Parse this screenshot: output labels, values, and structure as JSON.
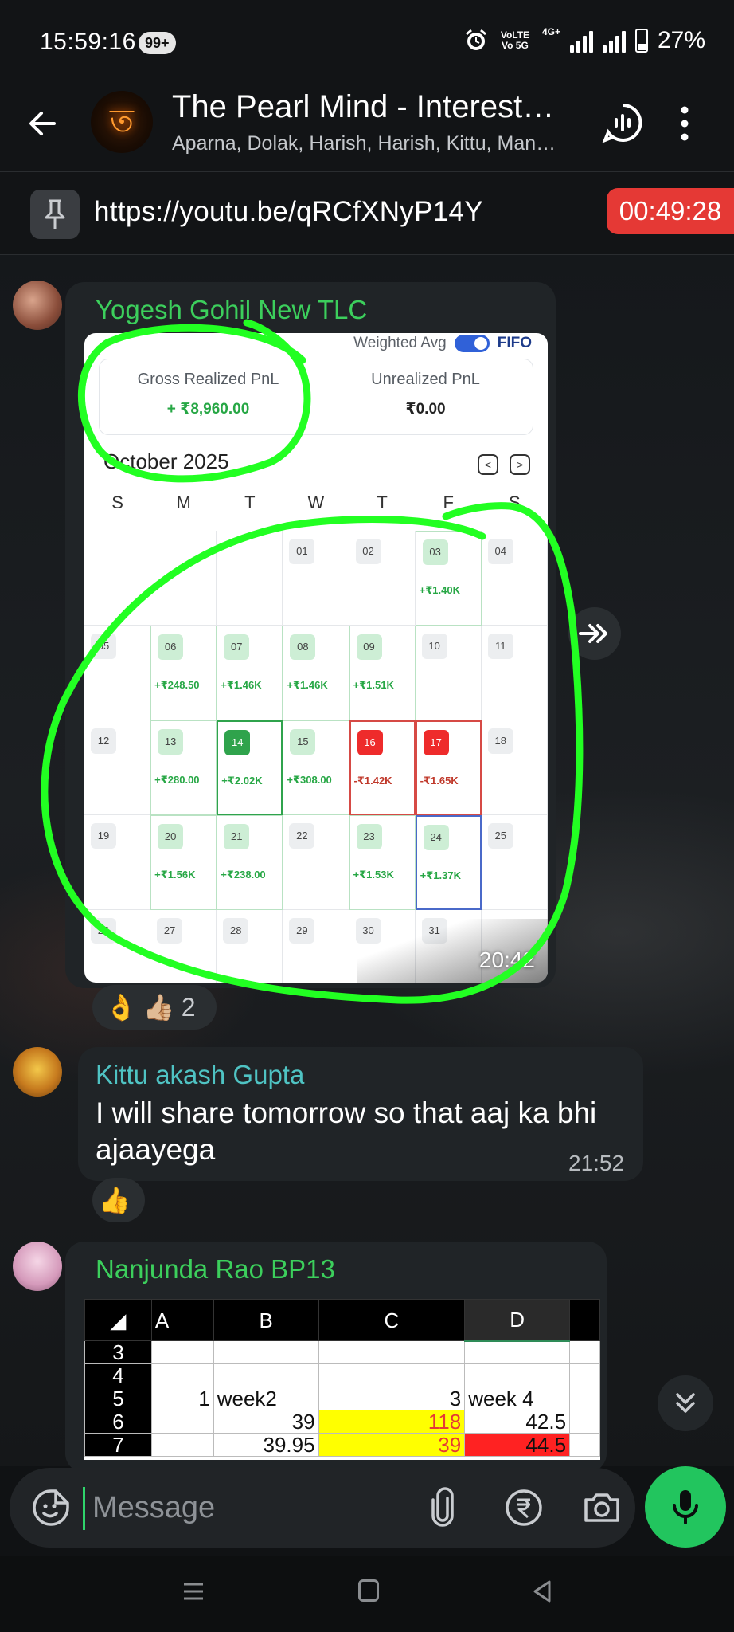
{
  "status_bar": {
    "time": "15:59:16",
    "notif_count": "99+",
    "network": "VoLTE Vo 5G",
    "net_type": "4G+",
    "battery": "27%"
  },
  "header": {
    "title": "The Pearl Mind - Intereste…",
    "subtitle": "Aparna, Dolak, Harish, Harish, Kittu, Man…",
    "avatar_glyph": "ত"
  },
  "pinned": {
    "link": "https://youtu.be/qRCfXNyP14Y",
    "timer": "00:49:28"
  },
  "messages": [
    {
      "sender": "Yogesh Gohil New TLC",
      "sender_color": "#3ccf5c",
      "time": "20:42",
      "reactions": {
        "emoji1": "👌",
        "emoji2": "👍🏼",
        "count": "2"
      },
      "screenshot": {
        "toggle_label": "Weighted Avg",
        "toggle_right": "FIFO",
        "gross_label": "Gross Realized PnL",
        "gross_value": "+ ₹8,960.00",
        "unrealized_label": "Unrealized PnL",
        "unrealized_value": "₹0.00",
        "month": "October 2025",
        "weekdays": [
          "S",
          "M",
          "T",
          "W",
          "T",
          "F",
          "S"
        ],
        "days": [
          {
            "d": "",
            "pnl": "",
            "state": "empty"
          },
          {
            "d": "",
            "pnl": "",
            "state": "empty"
          },
          {
            "d": "",
            "pnl": "",
            "state": "empty"
          },
          {
            "d": "01",
            "pnl": "",
            "state": "none"
          },
          {
            "d": "02",
            "pnl": "",
            "state": "none"
          },
          {
            "d": "03",
            "pnl": "+₹1.40K",
            "state": "gain"
          },
          {
            "d": "04",
            "pnl": "",
            "state": "none"
          },
          {
            "d": "05",
            "pnl": "",
            "state": "none"
          },
          {
            "d": "06",
            "pnl": "+₹248.50",
            "state": "gain"
          },
          {
            "d": "07",
            "pnl": "+₹1.46K",
            "state": "gain"
          },
          {
            "d": "08",
            "pnl": "+₹1.46K",
            "state": "gain"
          },
          {
            "d": "09",
            "pnl": "+₹1.51K",
            "state": "gain"
          },
          {
            "d": "10",
            "pnl": "",
            "state": "none"
          },
          {
            "d": "11",
            "pnl": "",
            "state": "none"
          },
          {
            "d": "12",
            "pnl": "",
            "state": "none"
          },
          {
            "d": "13",
            "pnl": "+₹280.00",
            "state": "gain"
          },
          {
            "d": "14",
            "pnl": "+₹2.02K",
            "state": "today"
          },
          {
            "d": "15",
            "pnl": "+₹308.00",
            "state": "gain"
          },
          {
            "d": "16",
            "pnl": "-₹1.42K",
            "state": "loss"
          },
          {
            "d": "17",
            "pnl": "-₹1.65K",
            "state": "loss"
          },
          {
            "d": "18",
            "pnl": "",
            "state": "none"
          },
          {
            "d": "19",
            "pnl": "",
            "state": "none"
          },
          {
            "d": "20",
            "pnl": "+₹1.56K",
            "state": "gain"
          },
          {
            "d": "21",
            "pnl": "+₹238.00",
            "state": "gain"
          },
          {
            "d": "22",
            "pnl": "",
            "state": "none"
          },
          {
            "d": "23",
            "pnl": "+₹1.53K",
            "state": "gain"
          },
          {
            "d": "24",
            "pnl": "+₹1.37K",
            "state": "sel"
          },
          {
            "d": "25",
            "pnl": "",
            "state": "none"
          },
          {
            "d": "26",
            "pnl": "",
            "state": "none"
          },
          {
            "d": "27",
            "pnl": "",
            "state": "none"
          },
          {
            "d": "28",
            "pnl": "",
            "state": "none"
          },
          {
            "d": "29",
            "pnl": "",
            "state": "none"
          },
          {
            "d": "30",
            "pnl": "",
            "state": "none"
          },
          {
            "d": "31",
            "pnl": "",
            "state": "none"
          },
          {
            "d": "",
            "pnl": "",
            "state": "none"
          }
        ]
      }
    },
    {
      "sender": "Kittu akash Gupta",
      "sender_color": "#4fc3c3",
      "line1": "I will share tomorrow so that aaj ka bhi",
      "line2": "ajaayega",
      "time": "21:52",
      "reaction": "👍"
    },
    {
      "sender": "Nanjunda Rao BP13",
      "sender_color": "#3ccf5c",
      "sheet": {
        "columns": [
          "A",
          "B",
          "C",
          "D"
        ],
        "rows": [
          {
            "n": "3",
            "a": "",
            "b": "",
            "c": "",
            "d": ""
          },
          {
            "n": "4",
            "a": "",
            "b": "",
            "c": "",
            "d": ""
          },
          {
            "n": "5",
            "a": "1",
            "b": "week2",
            "c": "3",
            "d": "week 4"
          },
          {
            "n": "6",
            "a": "",
            "b": "39",
            "c": "118",
            "d": "42.5"
          },
          {
            "n": "7",
            "a": "",
            "b": "39.95",
            "c": "39",
            "d": "44.5"
          }
        ]
      }
    }
  ],
  "composer": {
    "placeholder": "Message"
  },
  "colors": {
    "gain": "#27a745",
    "loss": "#c0392b",
    "accent": "#22c55e",
    "highlight": "#22ff22"
  }
}
